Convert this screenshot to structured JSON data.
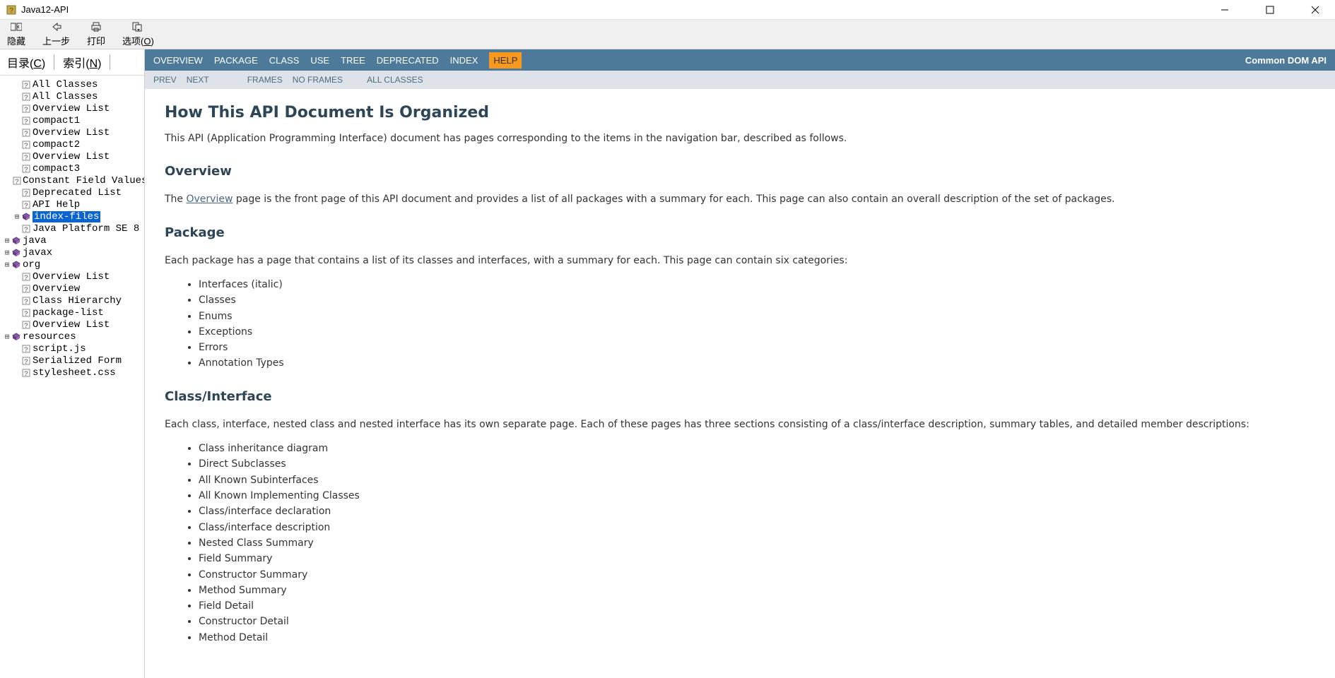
{
  "window": {
    "title": "Java12-API"
  },
  "toolbar": {
    "hide": "隐藏",
    "back": "上一步",
    "print": "打印",
    "options": "选项(O)"
  },
  "sidebar": {
    "tab_toc": "目录(C)",
    "tab_index": "索引(N)",
    "tree": [
      {
        "indent": 1,
        "exp": "",
        "icon": "q",
        "label": "All Classes"
      },
      {
        "indent": 1,
        "exp": "",
        "icon": "q",
        "label": "All Classes"
      },
      {
        "indent": 1,
        "exp": "",
        "icon": "q",
        "label": "Overview List"
      },
      {
        "indent": 1,
        "exp": "",
        "icon": "q",
        "label": "compact1"
      },
      {
        "indent": 1,
        "exp": "",
        "icon": "q",
        "label": "Overview List"
      },
      {
        "indent": 1,
        "exp": "",
        "icon": "q",
        "label": "compact2"
      },
      {
        "indent": 1,
        "exp": "",
        "icon": "q",
        "label": "Overview List"
      },
      {
        "indent": 1,
        "exp": "",
        "icon": "q",
        "label": "compact3"
      },
      {
        "indent": 1,
        "exp": "",
        "icon": "q",
        "label": "Constant Field Values"
      },
      {
        "indent": 1,
        "exp": "",
        "icon": "q",
        "label": "Deprecated List"
      },
      {
        "indent": 1,
        "exp": "",
        "icon": "q",
        "label": "API Help"
      },
      {
        "indent": 1,
        "exp": "⊞",
        "icon": "p",
        "label": "index-files",
        "selected": true
      },
      {
        "indent": 1,
        "exp": "",
        "icon": "q",
        "label": "Java Platform SE 8"
      },
      {
        "indent": 0,
        "exp": "⊞",
        "icon": "p",
        "label": "java"
      },
      {
        "indent": 0,
        "exp": "⊞",
        "icon": "p",
        "label": "javax"
      },
      {
        "indent": 0,
        "exp": "⊞",
        "icon": "p",
        "label": "org"
      },
      {
        "indent": 1,
        "exp": "",
        "icon": "q",
        "label": "Overview List"
      },
      {
        "indent": 1,
        "exp": "",
        "icon": "q",
        "label": "Overview"
      },
      {
        "indent": 1,
        "exp": "",
        "icon": "q",
        "label": "Class Hierarchy"
      },
      {
        "indent": 1,
        "exp": "",
        "icon": "q",
        "label": "package-list"
      },
      {
        "indent": 1,
        "exp": "",
        "icon": "q",
        "label": "Overview List"
      },
      {
        "indent": 0,
        "exp": "⊞",
        "icon": "p",
        "label": "resources"
      },
      {
        "indent": 1,
        "exp": "",
        "icon": "q",
        "label": "script.js"
      },
      {
        "indent": 1,
        "exp": "",
        "icon": "q",
        "label": "Serialized Form"
      },
      {
        "indent": 1,
        "exp": "",
        "icon": "q",
        "label": "stylesheet.css"
      }
    ]
  },
  "navbar": {
    "items": [
      "OVERVIEW",
      "PACKAGE",
      "CLASS",
      "USE",
      "TREE",
      "DEPRECATED",
      "INDEX",
      "HELP"
    ],
    "active_index": 7,
    "right": "Common DOM API"
  },
  "subnav": {
    "prev": "PREV",
    "next": "NEXT",
    "frames": "FRAMES",
    "no_frames": "NO FRAMES",
    "all_classes": "ALL CLASSES"
  },
  "doc": {
    "h1": "How This API Document Is Organized",
    "intro": "This API (Application Programming Interface) document has pages corresponding to the items in the navigation bar, described as follows.",
    "sec_overview_h": "Overview",
    "sec_overview_p_pre": "The ",
    "sec_overview_link": "Overview",
    "sec_overview_p_post": " page is the front page of this API document and provides a list of all packages with a summary for each. This page can also contain an overall description of the set of packages.",
    "sec_package_h": "Package",
    "sec_package_p": "Each package has a page that contains a list of its classes and interfaces, with a summary for each. This page can contain six categories:",
    "package_list": [
      "Interfaces (italic)",
      "Classes",
      "Enums",
      "Exceptions",
      "Errors",
      "Annotation Types"
    ],
    "sec_class_h": "Class/Interface",
    "sec_class_p": "Each class, interface, nested class and nested interface has its own separate page. Each of these pages has three sections consisting of a class/interface description, summary tables, and detailed member descriptions:",
    "class_list": [
      "Class inheritance diagram",
      "Direct Subclasses",
      "All Known Subinterfaces",
      "All Known Implementing Classes",
      "Class/interface declaration",
      "Class/interface description",
      "Nested Class Summary",
      "Field Summary",
      "Constructor Summary",
      "Method Summary",
      "Field Detail",
      "Constructor Detail",
      "Method Detail"
    ]
  }
}
